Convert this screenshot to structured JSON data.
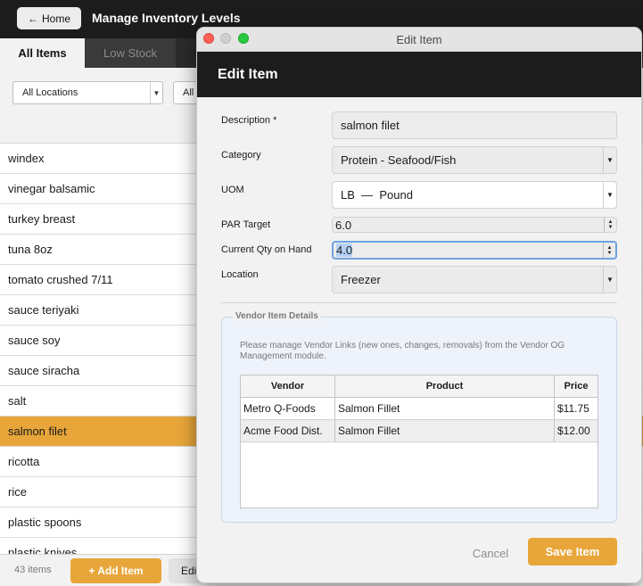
{
  "app": {
    "home_label": "Home",
    "home_icon": "arrow-left-icon",
    "title": "Manage Inventory Levels"
  },
  "tabs": [
    {
      "label": "All Items",
      "active": true
    },
    {
      "label": "Low Stock",
      "active": false
    }
  ],
  "filters": {
    "location": "All Locations",
    "second": "All"
  },
  "items": [
    {
      "name": "windex",
      "selected": false
    },
    {
      "name": "vinegar balsamic",
      "selected": false
    },
    {
      "name": "turkey breast",
      "selected": false
    },
    {
      "name": "tuna 8oz",
      "selected": false
    },
    {
      "name": "tomato crushed 7/11",
      "selected": false
    },
    {
      "name": "sauce teriyaki",
      "selected": false
    },
    {
      "name": "sauce soy",
      "selected": false
    },
    {
      "name": "sauce siracha",
      "selected": false
    },
    {
      "name": "salt",
      "selected": false
    },
    {
      "name": "salmon filet",
      "selected": true
    },
    {
      "name": "ricotta",
      "selected": false
    },
    {
      "name": "rice",
      "selected": false
    },
    {
      "name": "plastic spoons",
      "selected": false
    },
    {
      "name": "plastic knives",
      "selected": false
    }
  ],
  "footer": {
    "count": "43 items",
    "add_label": "+ Add Item",
    "edit_label": "Edit"
  },
  "modal": {
    "window_title": "Edit Item",
    "header_title": "Edit Item",
    "form": {
      "description_label": "Description *",
      "description_value": "salmon filet",
      "category_label": "Category",
      "category_value": "Protein - Seafood/Fish",
      "uom_label": "UOM",
      "uom_value": "LB  —  Pound",
      "par_label": "PAR Target",
      "par_value": "6.0",
      "qty_label": "Current Qty on Hand",
      "qty_value": "4.0",
      "location_label": "Location",
      "location_value": "Freezer"
    },
    "vendor": {
      "legend": "Vendor Item Details",
      "note": "Please manage Vendor Links (new ones, changes, removals) from the Vendor OG Management module.",
      "columns": [
        "Vendor",
        "Product",
        "Price"
      ],
      "rows": [
        {
          "vendor": "Metro Q-Foods",
          "product": "Salmon Fillet",
          "price": "$11.75"
        },
        {
          "vendor": "Acme Food Dist.",
          "product": "Salmon Fillet",
          "price": "$12.00"
        }
      ]
    },
    "cancel_label": "Cancel",
    "save_label": "Save Item"
  },
  "colors": {
    "accent": "#e8a63a",
    "header_dark": "#1c1c1c",
    "focus_ring": "#6fa3e0"
  }
}
